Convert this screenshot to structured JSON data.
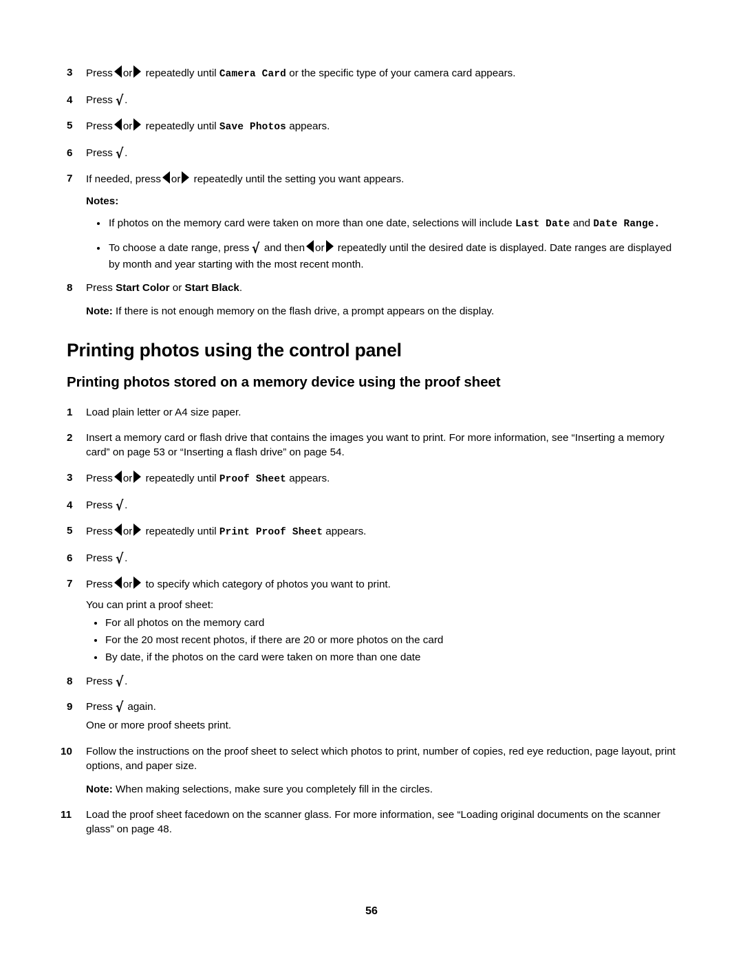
{
  "document": {
    "page_number": "56",
    "glyphs": {
      "arrow_left": "left-arrow-button-glyph",
      "arrow_right": "right-arrow-button-glyph",
      "check": "√",
      "bullet": "•"
    }
  },
  "section_top": {
    "steps": [
      {
        "number": "3",
        "parts": {
          "a": "Press",
          "b": "or",
          "c": "repeatedly until",
          "code": "Camera Card",
          "d": "or the specific type of your camera card appears."
        }
      },
      {
        "number": "4",
        "parts": {
          "a": "Press",
          "period": "."
        }
      },
      {
        "number": "5",
        "parts": {
          "a": "Press",
          "b": "or",
          "c": "repeatedly until",
          "code": "Save Photos",
          "d": "appears."
        }
      },
      {
        "number": "6",
        "parts": {
          "a": "Press",
          "period": "."
        }
      },
      {
        "number": "7",
        "parts": {
          "a": "If needed, press",
          "b": "or",
          "c": "repeatedly until the setting you want appears."
        }
      }
    ],
    "notes": {
      "heading": "Notes:",
      "items": [
        {
          "text_before": "If photos on the memory card were taken on more than one date, selections will include",
          "code1": "Last Date",
          "between": "and",
          "code2": "Date Range",
          "text_after": "."
        },
        {
          "p1": "To choose a date range, press",
          "p2": "and then",
          "p3": "or",
          "p4": "repeatedly until the desired date is displayed. Date ranges are displayed by month and year starting with the most recent month."
        }
      ]
    },
    "step8": {
      "number": "8",
      "press": "Press",
      "bold1": "Start Color",
      "or": "or",
      "bold2": "Start Black",
      "period": "."
    },
    "note_after_8": {
      "label": "Note:",
      "text": "If there is not enough memory on the flash drive, a prompt appears on the display."
    }
  },
  "headings": {
    "main": "Printing photos using the control panel",
    "sub": "Printing photos stored on a memory device using the proof sheet"
  },
  "section_proof": {
    "steps": [
      {
        "number": "1",
        "parts": {
          "a": "Load plain letter or A4 size paper."
        }
      },
      {
        "number": "2",
        "parts": {
          "a": "Insert a memory card or flash drive that contains the images you want to print. For more information, see “Inserting a memory card” on page 53 or “Inserting a flash drive” on page 54."
        }
      },
      {
        "number": "3",
        "parts": {
          "a": "Press",
          "b": "or",
          "c": "repeatedly until",
          "code": "Proof Sheet",
          "d": "appears."
        }
      },
      {
        "number": "4",
        "parts": {
          "a": "Press",
          "period": "."
        }
      },
      {
        "number": "5",
        "parts": {
          "a": "Press",
          "b": "or",
          "c": "repeatedly until",
          "code": "Print Proof Sheet",
          "d": "appears."
        }
      },
      {
        "number": "6",
        "parts": {
          "a": "Press",
          "period": "."
        }
      },
      {
        "number": "7",
        "parts": {
          "a": "Press",
          "b": "or",
          "c": "to specify which category of photos you want to print."
        }
      }
    ],
    "proof_intro": "You can print a proof sheet:",
    "proof_options": [
      "For all photos on the memory card",
      "For the 20 most recent photos, if there are 20 or more photos on the card",
      "By date, if the photos on the card were taken on more than one date"
    ],
    "step8": {
      "number": "8",
      "press": "Press",
      "period": "."
    },
    "step9": {
      "number": "9",
      "press": "Press",
      "after": "again."
    },
    "step9_result": "One or more proof sheets print.",
    "step10": {
      "number": "10",
      "text": "Follow the instructions on the proof sheet to select which photos to print, number of copies, red eye reduction, page layout, print options, and paper size."
    },
    "note_after_10": {
      "label": "Note:",
      "text": "When making selections, make sure you completely fill in the circles."
    },
    "step11": {
      "number": "11",
      "text": "Load the proof sheet facedown on the scanner glass. For more information, see “Loading original documents on the scanner glass” on page 48."
    }
  }
}
